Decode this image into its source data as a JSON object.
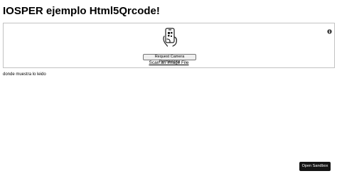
{
  "page": {
    "title": "IOSPER ejemplo Html5Qrcode!"
  },
  "reader": {
    "request_permissions_label": "Request Camera Permissions",
    "scan_image_label": "Scan an Image File",
    "info_icon": "info-icon",
    "scan_icon": "phone-qr-scan-icon"
  },
  "result": {
    "text": "donde muestra lo leido"
  },
  "sandbox": {
    "label": "Open Sandbox"
  }
}
